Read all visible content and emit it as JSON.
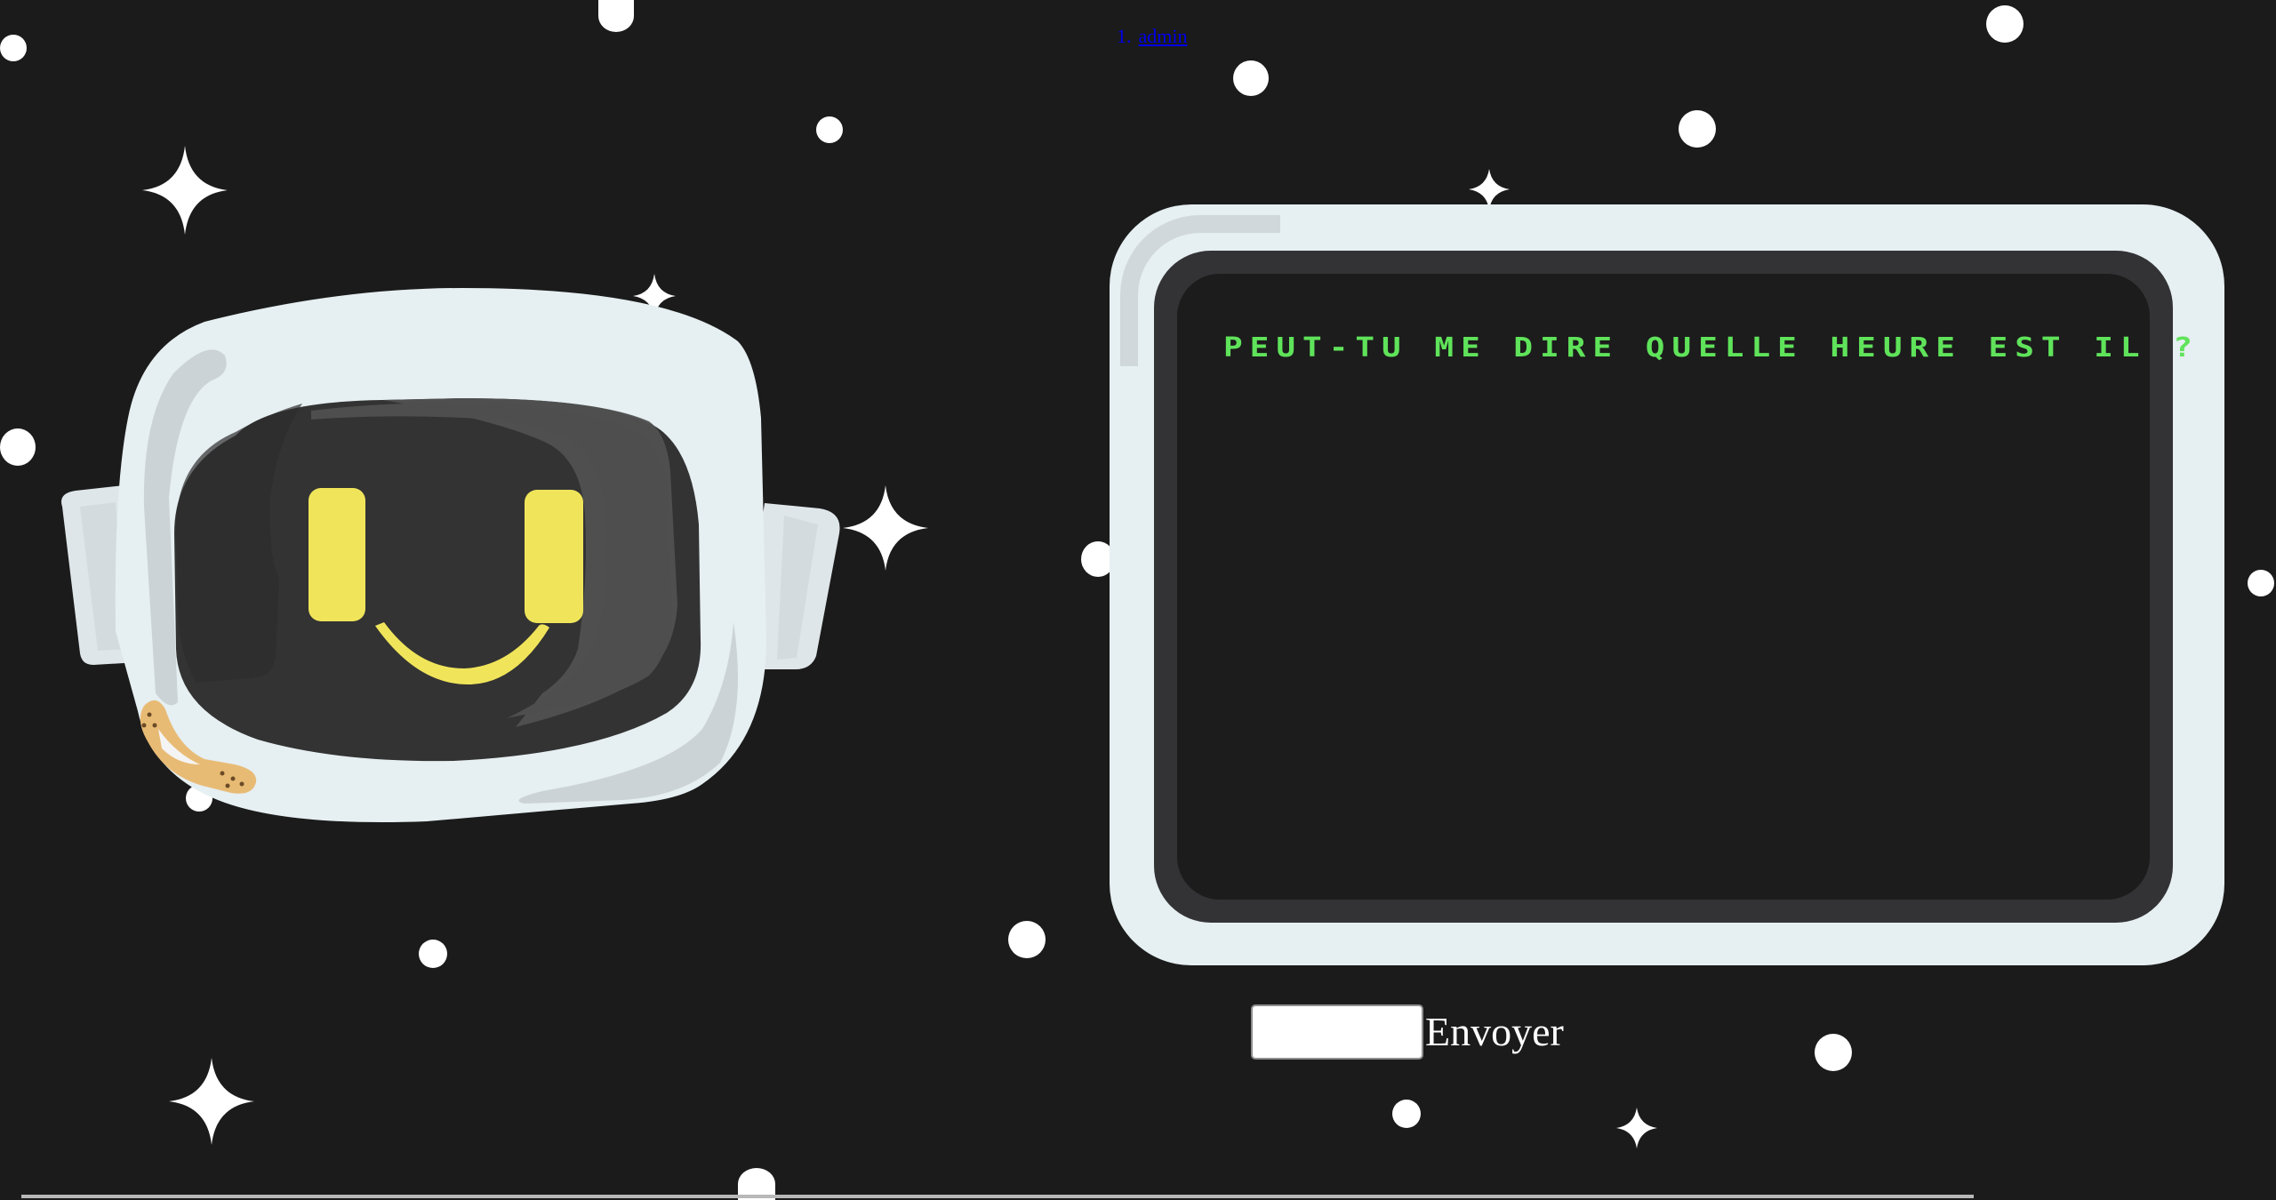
{
  "nav": {
    "items": [
      {
        "number": "1.",
        "label": "admin"
      }
    ]
  },
  "screen": {
    "message": "Peut-tu me dire quelle heure est il ?"
  },
  "chat": {
    "input_value": "",
    "input_placeholder": "",
    "send_label": "Envoyer"
  },
  "colors": {
    "background": "#1b1b1b",
    "screen_frame": "#e6eff1",
    "screen_bezel": "#333335",
    "screen_display": "#1c1c1c",
    "message_text": "#5fe35a",
    "robot_eyes": "#f0e55a",
    "robot_visor": "#3a3a3a",
    "robot_helmet": "#e6eff1",
    "bandage": "#e8bb75",
    "link": "#0000ee"
  },
  "icons": {
    "robot": "robot-head-icon",
    "stars": "star-dot-icon",
    "sparkles": "four-point-sparkle-icon"
  }
}
